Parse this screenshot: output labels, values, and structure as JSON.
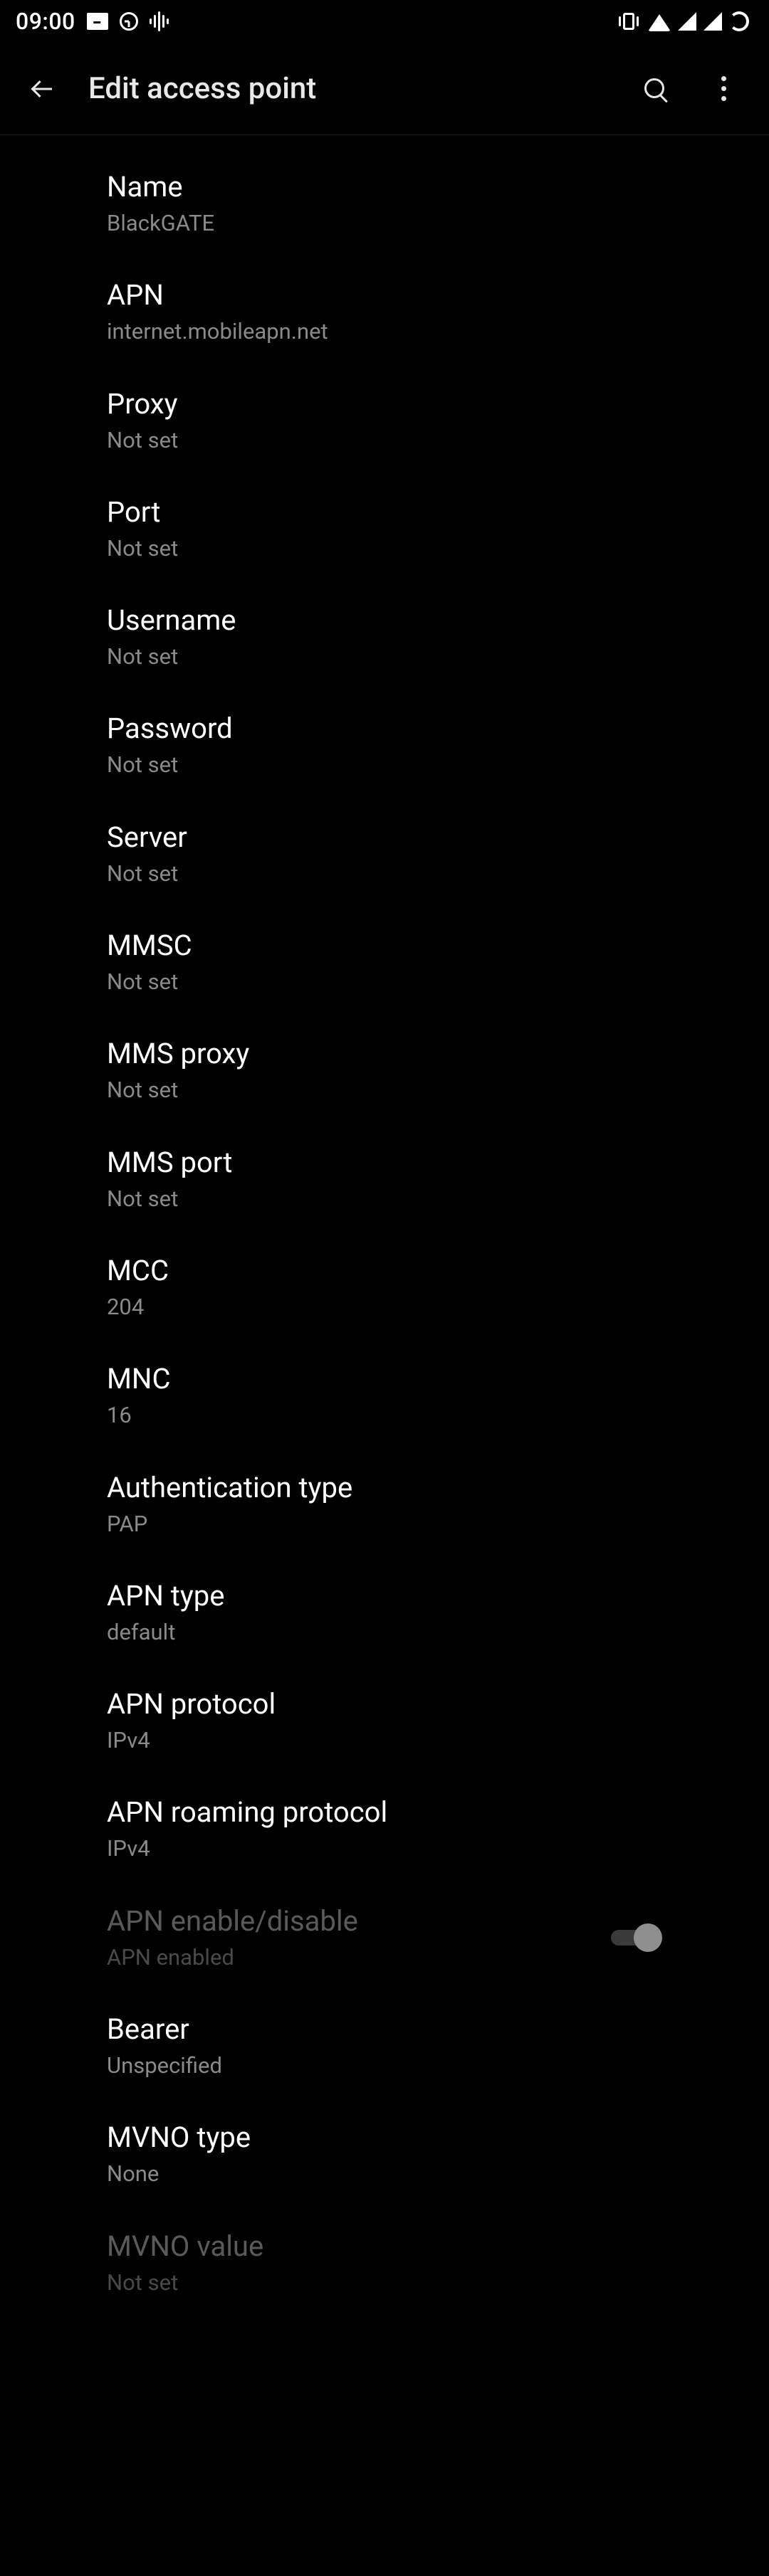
{
  "status_bar": {
    "time": "09:00"
  },
  "app_bar": {
    "title": "Edit access point"
  },
  "items": [
    {
      "title": "Name",
      "value": "BlackGATE",
      "disabled": false,
      "has_toggle": false
    },
    {
      "title": "APN",
      "value": "internet.mobileapn.net",
      "disabled": false,
      "has_toggle": false
    },
    {
      "title": "Proxy",
      "value": "Not set",
      "disabled": false,
      "has_toggle": false
    },
    {
      "title": "Port",
      "value": "Not set",
      "disabled": false,
      "has_toggle": false
    },
    {
      "title": "Username",
      "value": "Not set",
      "disabled": false,
      "has_toggle": false
    },
    {
      "title": "Password",
      "value": "Not set",
      "disabled": false,
      "has_toggle": false
    },
    {
      "title": "Server",
      "value": "Not set",
      "disabled": false,
      "has_toggle": false
    },
    {
      "title": "MMSC",
      "value": "Not set",
      "disabled": false,
      "has_toggle": false
    },
    {
      "title": "MMS proxy",
      "value": "Not set",
      "disabled": false,
      "has_toggle": false
    },
    {
      "title": "MMS port",
      "value": "Not set",
      "disabled": false,
      "has_toggle": false
    },
    {
      "title": "MCC",
      "value": "204",
      "disabled": false,
      "has_toggle": false
    },
    {
      "title": "MNC",
      "value": "16",
      "disabled": false,
      "has_toggle": false
    },
    {
      "title": "Authentication type",
      "value": "PAP",
      "disabled": false,
      "has_toggle": false
    },
    {
      "title": "APN type",
      "value": "default",
      "disabled": false,
      "has_toggle": false
    },
    {
      "title": "APN protocol",
      "value": "IPv4",
      "disabled": false,
      "has_toggle": false
    },
    {
      "title": "APN roaming protocol",
      "value": "IPv4",
      "disabled": false,
      "has_toggle": false
    },
    {
      "title": "APN enable/disable",
      "value": "APN enabled",
      "disabled": true,
      "has_toggle": true,
      "toggle_on": true
    },
    {
      "title": "Bearer",
      "value": "Unspecified",
      "disabled": false,
      "has_toggle": false
    },
    {
      "title": "MVNO type",
      "value": "None",
      "disabled": false,
      "has_toggle": false
    },
    {
      "title": "MVNO value",
      "value": "Not set",
      "disabled": true,
      "has_toggle": false
    }
  ]
}
